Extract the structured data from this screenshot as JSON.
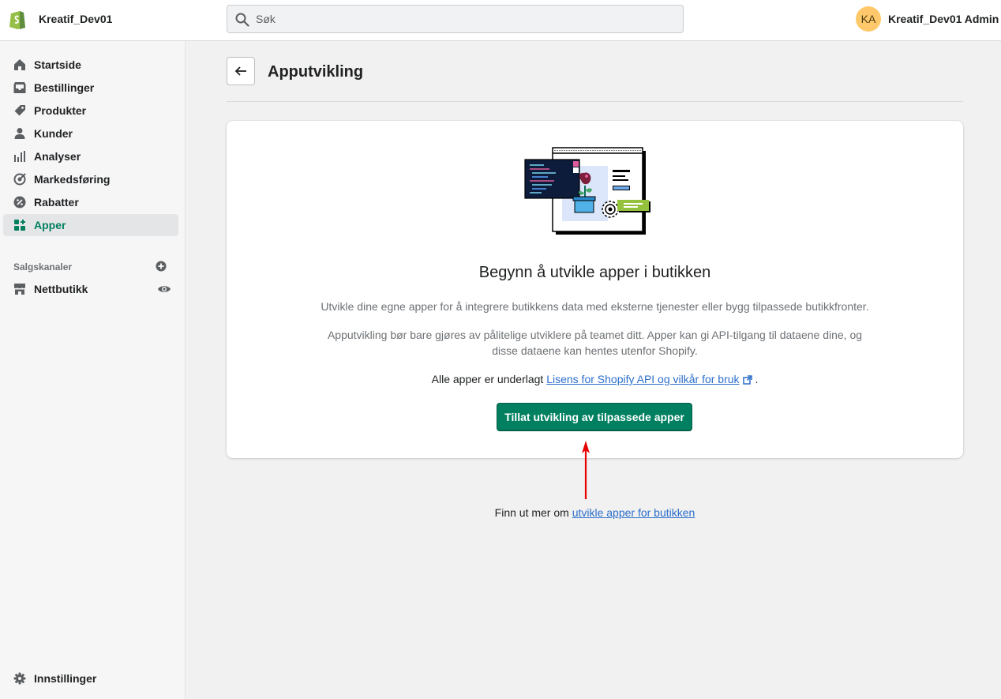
{
  "topbar": {
    "store_name": "Kreatif_Dev01",
    "search_placeholder": "Søk",
    "avatar_initials": "KA",
    "user_name": "Kreatif_Dev01 Admin"
  },
  "sidebar": {
    "items": [
      {
        "label": "Startside",
        "icon": "home-icon"
      },
      {
        "label": "Bestillinger",
        "icon": "inbox-icon"
      },
      {
        "label": "Produkter",
        "icon": "tag-icon"
      },
      {
        "label": "Kunder",
        "icon": "person-icon"
      },
      {
        "label": "Analyser",
        "icon": "bar-chart-icon"
      },
      {
        "label": "Markedsføring",
        "icon": "target-icon"
      },
      {
        "label": "Rabatter",
        "icon": "discount-icon"
      },
      {
        "label": "Apper",
        "icon": "apps-icon",
        "active": true
      }
    ],
    "sales_channels_title": "Salgskanaler",
    "sales_channels": [
      {
        "label": "Nettbutikk",
        "icon": "store-icon"
      }
    ],
    "settings_label": "Innstillinger"
  },
  "page": {
    "title": "Apputvikling"
  },
  "card": {
    "heading": "Begynn å utvikle apper i butikken",
    "text1": "Utvikle dine egne apper for å integrere butikkens data med eksterne tjenester eller bygg tilpassede butikkfronter.",
    "text2_line1": "Apputvikling bør bare gjøres av pålitelige utviklere på teamet ditt. Apper kan gi API-tilgang til dataene dine, og",
    "text2_line2": "disse dataene kan hentes utenfor Shopify.",
    "text3_prefix": "Alle apper er underlagt",
    "text3_link": "Lisens for Shopify API og vilkår for bruk",
    "text3_suffix": ".",
    "button_label": "Tillat utvikling av tilpassede apper"
  },
  "footer": {
    "prefix": "Finn ut mer om",
    "link": "utvikle apper for butikken"
  },
  "colors": {
    "accent_green": "#008060",
    "active_nav_text": "#007f5f",
    "link_blue": "#2c6ecb",
    "annotation_arrow": "#e60000",
    "avatar_bg": "#ffc96b"
  }
}
